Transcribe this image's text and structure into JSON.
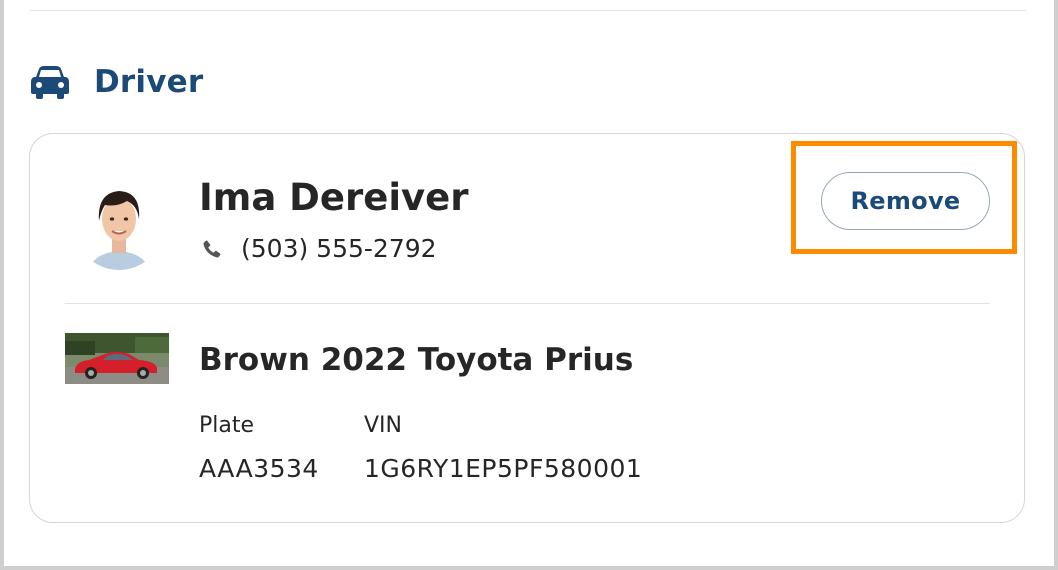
{
  "section": {
    "title": "Driver",
    "icon": "car-icon"
  },
  "driver": {
    "name": "Ima Dereiver",
    "phone": "(503) 555-2792",
    "phone_icon": "phone-icon",
    "avatar": "avatar-photo",
    "remove_label": "Remove"
  },
  "vehicle": {
    "title": "Brown 2022 Toyota Prius",
    "thumbnail": "vehicle-photo",
    "plate_label": "Plate",
    "plate_value": "AAA3534",
    "vin_label": "VIN",
    "vin_value": "1G6RY1EP5PF580001"
  },
  "colors": {
    "accent": "#1b4a78",
    "highlight": "#ff8a00",
    "text": "#262626",
    "border": "#d6d6d6"
  }
}
